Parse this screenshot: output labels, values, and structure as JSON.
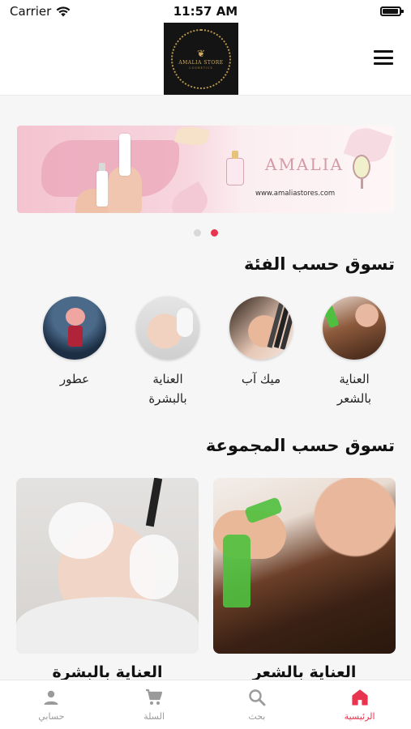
{
  "status_bar": {
    "carrier": "Carrier",
    "time": "11:57 AM"
  },
  "header": {
    "logo_text": "AMALIA STORE",
    "logo_subtext": "COSMETICS"
  },
  "banner": {
    "brand": "AMALIA",
    "url": "www.amaliastores.com",
    "slides_total": 2,
    "active_slide": 2
  },
  "sections": {
    "categories_title": "تسوق حسب الفئة",
    "collections_title": "تسوق حسب المجموعة"
  },
  "categories": [
    {
      "label": "العناية\nبالشعر",
      "icon": "hair-care-image"
    },
    {
      "label": "ميك آب",
      "icon": "makeup-image"
    },
    {
      "label": "العناية\nبالبشرة",
      "icon": "skin-care-image"
    },
    {
      "label": "عطور",
      "icon": "perfume-image"
    }
  ],
  "collections": [
    {
      "label": "العناية بالشعر"
    },
    {
      "label": "العناية بالبشرة"
    }
  ],
  "tab_bar": {
    "home": "الرئيسية",
    "search": "بحث",
    "cart": "السلة",
    "account": "حسابي",
    "active_tab": "home"
  },
  "colors": {
    "accent": "#e8344f",
    "inactive": "#9a9a9a",
    "logo_gold": "#cfae62"
  }
}
